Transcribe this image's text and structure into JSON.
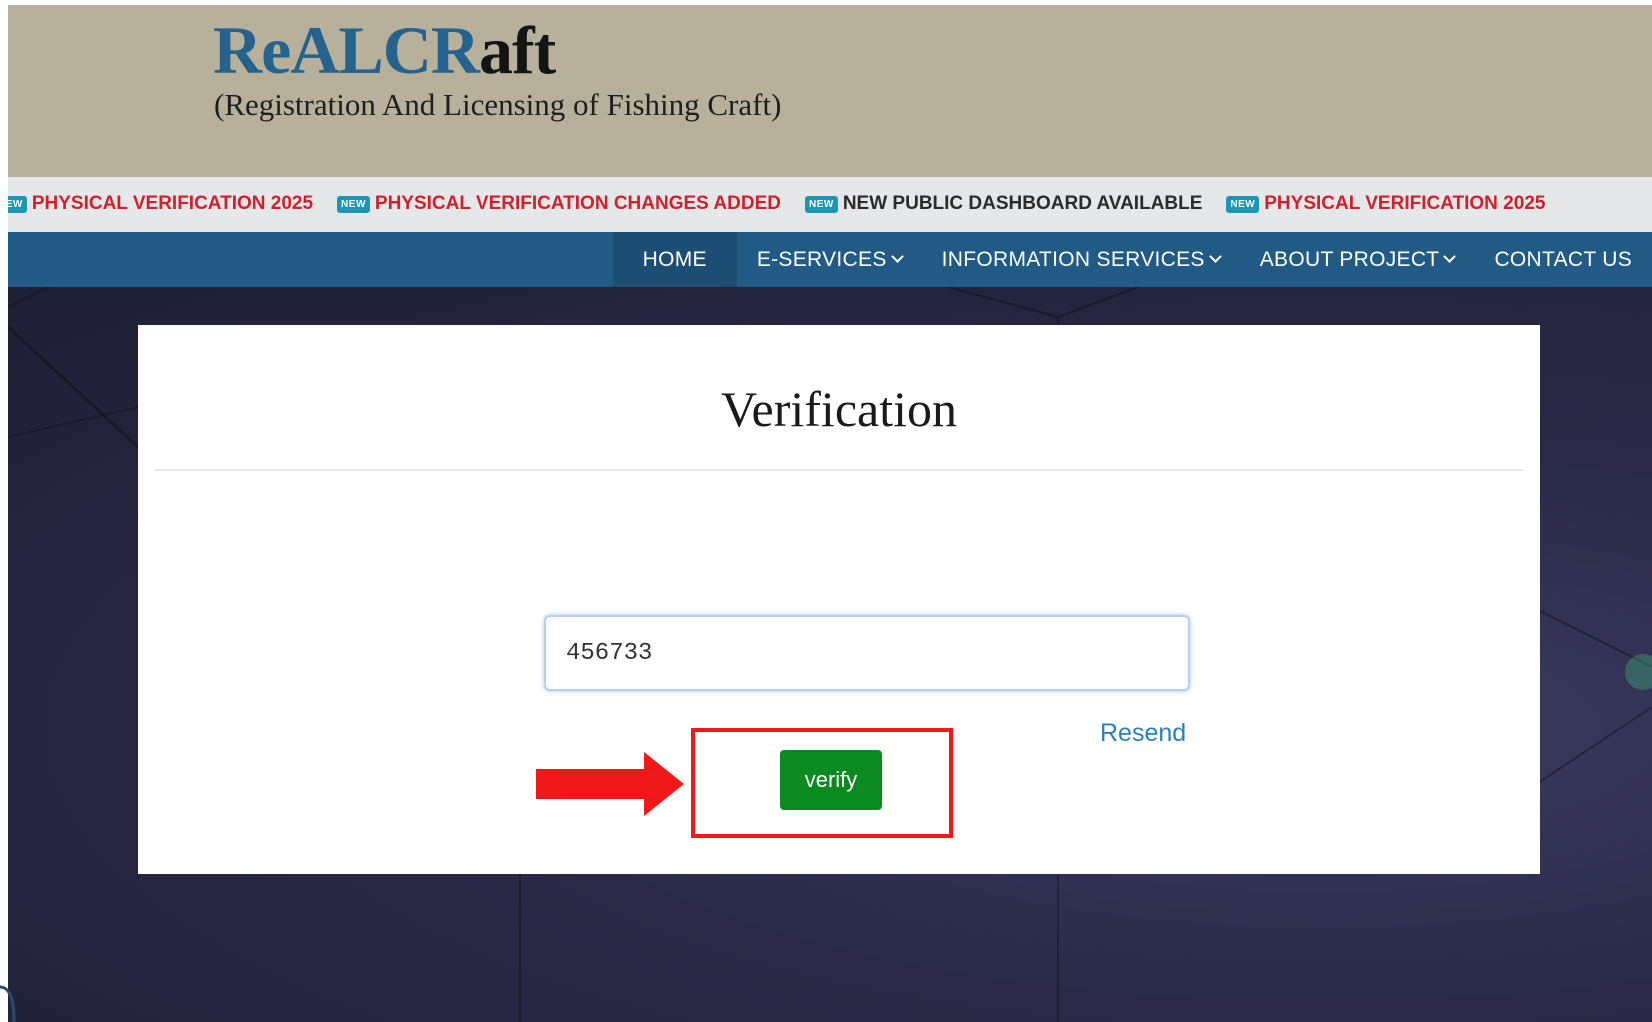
{
  "header": {
    "logo_part1": "ReALCR",
    "logo_part2": "aft",
    "tagline": "(Registration And Licensing of Fishing Craft)"
  },
  "ticker": {
    "badge_label": "NEW",
    "items": [
      {
        "text": "PHYSICAL VERIFICATION 2025",
        "color": "#d1202b"
      },
      {
        "text": "PHYSICAL VERIFICATION CHANGES ADDED",
        "color": "#d1202b"
      },
      {
        "text": "NEW PUBLIC DASHBOARD AVAILABLE",
        "color": "#2b2b2b"
      },
      {
        "text": "PHYSICAL VERIFICATION 2025",
        "color": "#d1202b"
      }
    ]
  },
  "nav": {
    "items": [
      {
        "label": "HOME",
        "active": true,
        "dropdown": false
      },
      {
        "label": "E-SERVICES",
        "active": false,
        "dropdown": true
      },
      {
        "label": "INFORMATION SERVICES",
        "active": false,
        "dropdown": true
      },
      {
        "label": "ABOUT PROJECT",
        "active": false,
        "dropdown": true
      },
      {
        "label": "CONTACT US",
        "active": false,
        "dropdown": false
      }
    ]
  },
  "verification": {
    "title": "Verification",
    "otp_value": "456733",
    "resend_label": "Resend",
    "verify_label": "verify"
  },
  "colors": {
    "header_bg": "#b7b09b",
    "nav_bg": "#215a84",
    "verify_button": "#0b8a1f",
    "highlight": "#f01818"
  }
}
